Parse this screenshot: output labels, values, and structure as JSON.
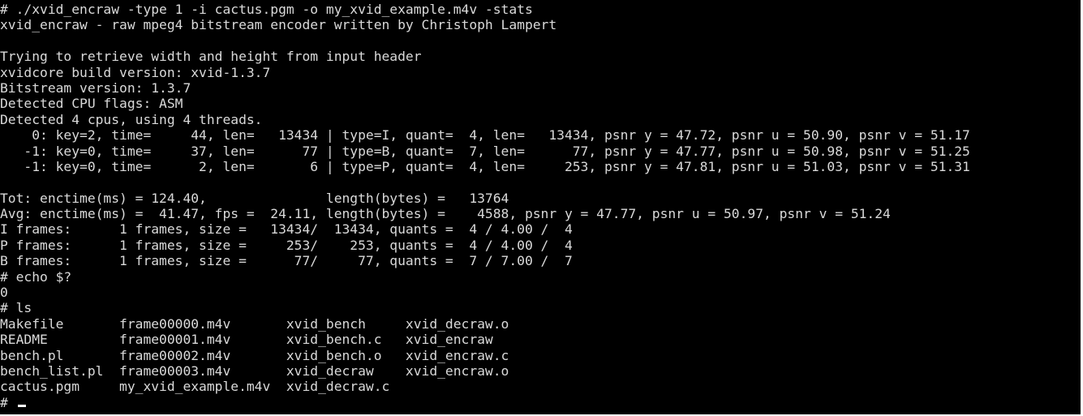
{
  "terminal": {
    "lines": [
      "# ./xvid_encraw -type 1 -i cactus.pgm -o my_xvid_example.m4v -stats",
      "xvid_encraw - raw mpeg4 bitstream encoder written by Christoph Lampert",
      "",
      "Trying to retrieve width and height from input header",
      "xvidcore build version: xvid-1.3.7",
      "Bitstream version: 1.3.7",
      "Detected CPU flags: ASM",
      "Detected 4 cpus, using 4 threads.",
      "    0: key=2, time=     44, len=   13434 | type=I, quant=  4, len=   13434, psnr y = 47.72, psnr u = 50.90, psnr v = 51.17",
      "   -1: key=0, time=     37, len=      77 | type=B, quant=  7, len=      77, psnr y = 47.77, psnr u = 50.98, psnr v = 51.25",
      "   -1: key=0, time=      2, len=       6 | type=P, quant=  4, len=     253, psnr y = 47.81, psnr u = 51.03, psnr v = 51.31",
      "",
      "Tot: enctime(ms) = 124.40,               length(bytes) =   13764",
      "Avg: enctime(ms) =  41.47, fps =  24.11, length(bytes) =    4588, psnr y = 47.77, psnr u = 50.97, psnr v = 51.24",
      "I frames:      1 frames, size =   13434/  13434, quants =  4 / 4.00 /  4",
      "P frames:      1 frames, size =     253/    253, quants =  4 / 4.00 /  4",
      "B frames:      1 frames, size =      77/     77, quants =  7 / 7.00 /  7",
      "# echo $?",
      "0",
      "# ls",
      "Makefile       frame00000.m4v       xvid_bench     xvid_decraw.o",
      "README         frame00001.m4v       xvid_bench.c   xvid_encraw",
      "bench.pl       frame00002.m4v       xvid_bench.o   xvid_encraw.c",
      "bench_list.pl  frame00003.m4v       xvid_decraw    xvid_encraw.o",
      "cactus.pgm     my_xvid_example.m4v  xvid_decraw.c"
    ],
    "prompt": "# ",
    "colors": {
      "background": "#000000",
      "foreground": "#d9d9d9",
      "cursor": "#ffffff"
    }
  }
}
